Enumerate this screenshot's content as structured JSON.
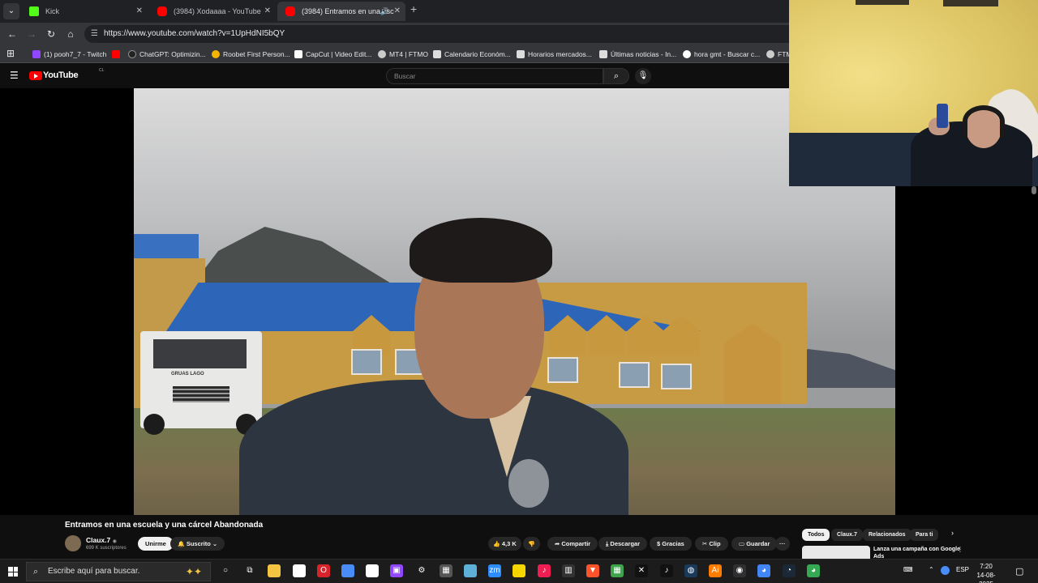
{
  "browser": {
    "tabs": [
      {
        "label": "Kick",
        "close": "✕",
        "color": "#53fc18"
      },
      {
        "label": "(3984) Xodaaaa - YouTube",
        "close": "✕",
        "color": "#ff0000"
      },
      {
        "label": "(3984) Entramos en una esc",
        "close": "✕",
        "color": "#ff0000",
        "audio": "🔊"
      }
    ],
    "new_tab": "+",
    "tab_dropdown": "⌄",
    "url": "https://www.youtube.com/watch?v=1UpHdNI5bQY",
    "nav": {
      "back": "←",
      "forward": "→",
      "reload": "↻",
      "home": "⌂",
      "tune": "☰"
    },
    "apps_icon": "⊞",
    "bookmarks": [
      {
        "label": "(1) pooh7_7 - Twitch",
        "color": "#9146ff"
      },
      {
        "label": "",
        "color": "#ff0000"
      },
      {
        "label": "ChatGPT: Optimizin...",
        "color": "#222222"
      },
      {
        "label": "Roobet First Person...",
        "color": "#f5b400"
      },
      {
        "label": "CapCut | Video Edit...",
        "color": "#111111"
      },
      {
        "label": "MT4 | FTMO",
        "color": "#666666"
      },
      {
        "label": "Calendario Económ...",
        "color": "#444444"
      },
      {
        "label": "Horarios mercados...",
        "color": "#444444"
      },
      {
        "label": "Últimas noticias - In...",
        "color": "#444444"
      },
      {
        "label": "hora gmt - Buscar c...",
        "color": "#4285f4"
      },
      {
        "label": "FTM",
        "color": "#666666"
      }
    ]
  },
  "youtube": {
    "menu_icon": "☰",
    "logo_text": "YouTube",
    "logo_region": "CL",
    "search_placeholder": "Buscar",
    "search_icon": "⌕",
    "mic_icon": "🎙",
    "video": {
      "title": "Entramos en una escuela y una cárcel Abandonada",
      "channel": "Claux.7",
      "verified": "◉",
      "subscribers": "699 K suscriptores",
      "join": "Unirme",
      "subscribed": "Suscrito",
      "subscribed_bell": "🔔",
      "subscribed_chevron": "⌄",
      "likes": "4,3 K",
      "like_icon": "👍",
      "dislike_icon": "👎",
      "share": "Compartir",
      "download": "Descargar",
      "thanks": "Gracias",
      "clip": "Clip",
      "save": "Guardar",
      "more": "···",
      "truck_text": "GRUAS LAGO"
    },
    "chips": [
      "Todos",
      "Claux.7",
      "Relacionados",
      "Para ti"
    ],
    "chips_next": "›",
    "ad": {
      "text": "Lanza una campaña con Google Ads",
      "menu": "⋮"
    }
  },
  "taskbar": {
    "search_placeholder": "Escribe aquí para buscar.",
    "search_icon": "⌕",
    "spark": "✦✦",
    "lang": "ESP",
    "time": "7:20",
    "date": "14-08-2025",
    "tray_chevron": "⌃",
    "notification_icon": "▢",
    "keyboard_icon": "⌨",
    "icons": [
      {
        "name": "cortana",
        "glyph": "○",
        "color": "transparent"
      },
      {
        "name": "task-view",
        "glyph": "⧉",
        "color": "transparent"
      },
      {
        "name": "file-explorer",
        "glyph": "",
        "color": "#f3c542"
      },
      {
        "name": "file",
        "glyph": "",
        "color": "#ffffff"
      },
      {
        "name": "opera",
        "glyph": "O",
        "color": "#d8232a"
      },
      {
        "name": "copilot",
        "glyph": "",
        "color": "#4a8cf7"
      },
      {
        "name": "document",
        "glyph": "",
        "color": "#ffffff"
      },
      {
        "name": "twitch",
        "glyph": "▣",
        "color": "#9146ff"
      },
      {
        "name": "settings",
        "glyph": "⚙",
        "color": "transparent"
      },
      {
        "name": "calculator",
        "glyph": "▦",
        "color": "#555555"
      },
      {
        "name": "notes",
        "glyph": "",
        "color": "#5fb0d8"
      },
      {
        "name": "zoom",
        "glyph": "zm",
        "color": "#2d8cff"
      },
      {
        "name": "sticky",
        "glyph": "",
        "color": "#f7d600"
      },
      {
        "name": "tiktok-capcut",
        "glyph": "♪",
        "color": "#ee1d52"
      },
      {
        "name": "app",
        "glyph": "▥",
        "color": "#333333"
      },
      {
        "name": "brave",
        "glyph": "▼",
        "color": "#fb542b"
      },
      {
        "name": "minecraft",
        "glyph": "▦",
        "color": "#3fa34d"
      },
      {
        "name": "capcut",
        "glyph": "✕",
        "color": "#111111"
      },
      {
        "name": "tiktok",
        "glyph": "♪",
        "color": "#111111"
      },
      {
        "name": "app2",
        "glyph": "◍",
        "color": "#1a3a5a"
      },
      {
        "name": "ai",
        "glyph": "Ai",
        "color": "#ff7c00"
      },
      {
        "name": "obs",
        "glyph": "◉",
        "color": "#302e31"
      },
      {
        "name": "chrome-2",
        "glyph": "◕",
        "color": "#4285f4"
      },
      {
        "name": "steam",
        "glyph": "◔",
        "color": "#1b2838"
      },
      {
        "name": "chrome",
        "glyph": "◕",
        "color": "#34a853"
      }
    ]
  }
}
